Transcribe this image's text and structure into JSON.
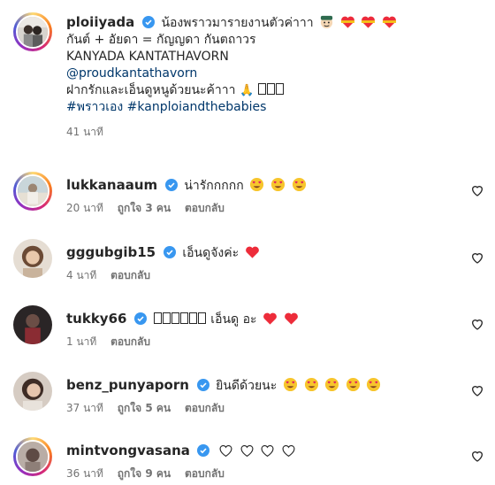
{
  "caption": {
    "username": "ploiiyada",
    "line1": "น้องพราวมารายงานตัวค่าาา",
    "line2": "กันต์ + อัยดา = กัญญดา กันตถาวร",
    "line3": "KANYADA KANTATHAVORN",
    "mention": "@proudkantathavorn",
    "line5": "ฝากรักและเอ็นดูหนูด้วยนะค้าาา",
    "hashtags": "#พราวเอง #kanploiandthebabies",
    "time": "41 นาที"
  },
  "comments": [
    {
      "username": "lukkanaaum",
      "text": "น่ารักกกกก",
      "time": "20 นาที",
      "likes": "ถูกใจ 3 คน",
      "reply": "ตอบกลับ"
    },
    {
      "username": "gggubgib15",
      "text": "เอ็นดูจังค่ะ",
      "time": "4 นาที",
      "reply": "ตอบกลับ"
    },
    {
      "username": "tukky66",
      "text": "เอ็นดู อะ",
      "time": "1 นาที",
      "reply": "ตอบกลับ"
    },
    {
      "username": "benz_punyaporn",
      "text": "ยินดีด้วยนะ",
      "time": "37 นาที",
      "likes": "ถูกใจ 5 คน",
      "reply": "ตอบกลับ"
    },
    {
      "username": "mintvongvasana",
      "text": "",
      "time": "36 นาที",
      "likes": "ถูกใจ 9 คน",
      "reply": "ตอบกลับ"
    }
  ],
  "icons": {
    "verified": "verified-badge-icon",
    "like": "heart-outline-icon"
  },
  "colors": {
    "text": "#262626",
    "muted": "#737373",
    "link": "#00376b",
    "verified": "#3897f0",
    "heart_red": "#ed2c3a",
    "emoji_yellow": "#f7c52c"
  }
}
